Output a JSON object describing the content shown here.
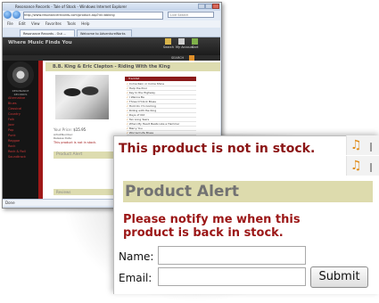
{
  "browser": {
    "window_title": "Resonance Records - Tale of Stock - Windows Internet Explorer",
    "url": "http://www.resonancerecords.com/product.asp?id=bbking",
    "search_placeholder": "Live Search",
    "menu": [
      "File",
      "Edit",
      "View",
      "Favorites",
      "Tools",
      "Help"
    ],
    "tabs": [
      "Resonance Records - Out ...",
      "Welcome to AdventureWorks"
    ],
    "status": "Done"
  },
  "site": {
    "title": "Where Music Finds You",
    "header_links": [
      "Search",
      "My Account",
      "Cart"
    ],
    "search_label": "SEARCH",
    "logo_text": "RESONANCE RECORDS",
    "nav": [
      "Alternative",
      "Blues",
      "Classical",
      "Country",
      "Folk",
      "Jazz",
      "Pop",
      "Punk",
      "Reggae",
      "Rock",
      "Rock & Roll",
      "Soundtrack"
    ]
  },
  "product": {
    "title": "B.B. King & Eric Clapton - Riding With the King",
    "tracklist_heading": "Tracklist",
    "tracks": [
      "Come Rain or Come Shine",
      "Help the Poor",
      "Key to the Highway",
      "I Wanna Be",
      "Three O'Clock Blues",
      "Hold On I'm Coming",
      "Riding with the King",
      "Days of Old",
      "Ten Long Years",
      "When My Heart Beats Like a Hammer",
      "Marry You",
      "Worried Life Blues"
    ],
    "price_label": "Your Price:",
    "price": "$15.95",
    "small_lines": [
      "Artist/Number:",
      "Release Date:"
    ],
    "stock_message": "This product is not in stock.",
    "alert_heading": "Product Alert",
    "notify_text": "Please notify me when this product is back in stock.",
    "reviews_heading": "Reviews"
  },
  "form": {
    "name_label": "Name:",
    "email_label": "Email:",
    "name_value": "",
    "email_value": "",
    "submit_label": "Submit"
  },
  "colors": {
    "stock_red": "#8b1414",
    "alert_bar": "#dddbad",
    "site_red": "#a01818"
  }
}
